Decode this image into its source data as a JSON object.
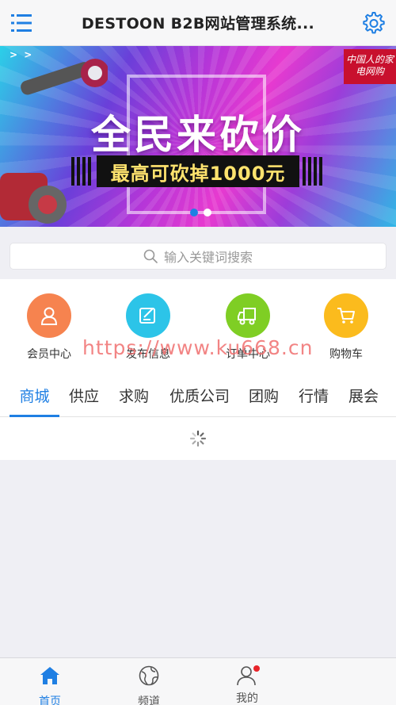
{
  "header": {
    "title": "DESTOON B2B网站管理系统..."
  },
  "banner": {
    "headline": "全民来砍价",
    "subline": "最高可砍掉1000元",
    "logo_text": "中国人的家电网购",
    "arrows": "> >",
    "active_slide": 1,
    "slide_count": 2
  },
  "search": {
    "placeholder": "输入关键词搜索"
  },
  "shortcuts": [
    {
      "label": "会员中心",
      "icon": "user-icon",
      "color": "#f6834f"
    },
    {
      "label": "发布信息",
      "icon": "edit-icon",
      "color": "#2cc4e8"
    },
    {
      "label": "订单中心",
      "icon": "truck-icon",
      "color": "#7fce24"
    },
    {
      "label": "购物车",
      "icon": "cart-icon",
      "color": "#fbbb1d"
    }
  ],
  "watermark": "https://www.ku668.cn",
  "tabs": [
    {
      "label": "商城",
      "active": true
    },
    {
      "label": "供应"
    },
    {
      "label": "求购"
    },
    {
      "label": "优质公司"
    },
    {
      "label": "团购"
    },
    {
      "label": "行情"
    },
    {
      "label": "展会"
    }
  ],
  "bottom_nav": [
    {
      "label": "首页",
      "icon": "home-icon",
      "active": true
    },
    {
      "label": "频道",
      "icon": "globe-icon"
    },
    {
      "label": "我的",
      "icon": "profile-icon",
      "badge": true
    }
  ],
  "colors": {
    "accent": "#1f7fe3",
    "badge": "#e8242a"
  }
}
